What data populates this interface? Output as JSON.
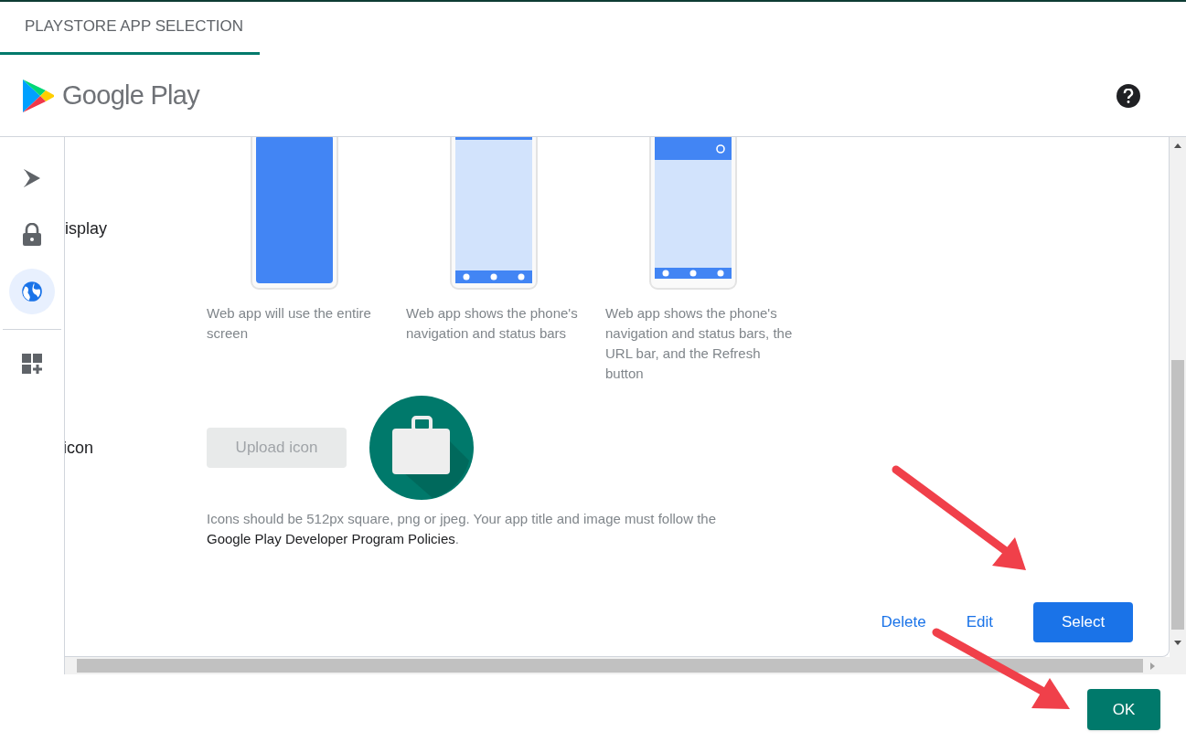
{
  "tabs": [
    {
      "label": "PLAYSTORE APP SELECTION",
      "selected": true
    }
  ],
  "header": {
    "logo_text": "Google Play"
  },
  "rail": [
    {
      "kind": "play",
      "selected": false
    },
    {
      "kind": "lock",
      "selected": false
    },
    {
      "kind": "globe",
      "selected": true
    },
    {
      "kind": "apps-add",
      "selected": false
    }
  ],
  "display": {
    "label": "isplay",
    "options": [
      {
        "kind": "fullscreen",
        "text": "Web app will use the entire screen"
      },
      {
        "kind": "standalone",
        "text": "Web app shows the phone's navigation and status bars"
      },
      {
        "kind": "minimal-ui",
        "text": "Web app shows the phone's navigation and status bars, the URL bar, and the Refresh button"
      }
    ]
  },
  "icon": {
    "label": "icon",
    "upload_button": {
      "label": "Upload icon",
      "disabled": true
    },
    "note": "Icons should be 512px square, png or jpeg. Your app title and image must follow the",
    "link": "Google Play Developer Program Policies",
    "note_end": "."
  },
  "actions": [
    {
      "kind": "text",
      "label": "Delete"
    },
    {
      "kind": "text",
      "label": "Edit"
    },
    {
      "kind": "primary",
      "label": "Select"
    }
  ],
  "ok_button": {
    "label": "OK"
  }
}
